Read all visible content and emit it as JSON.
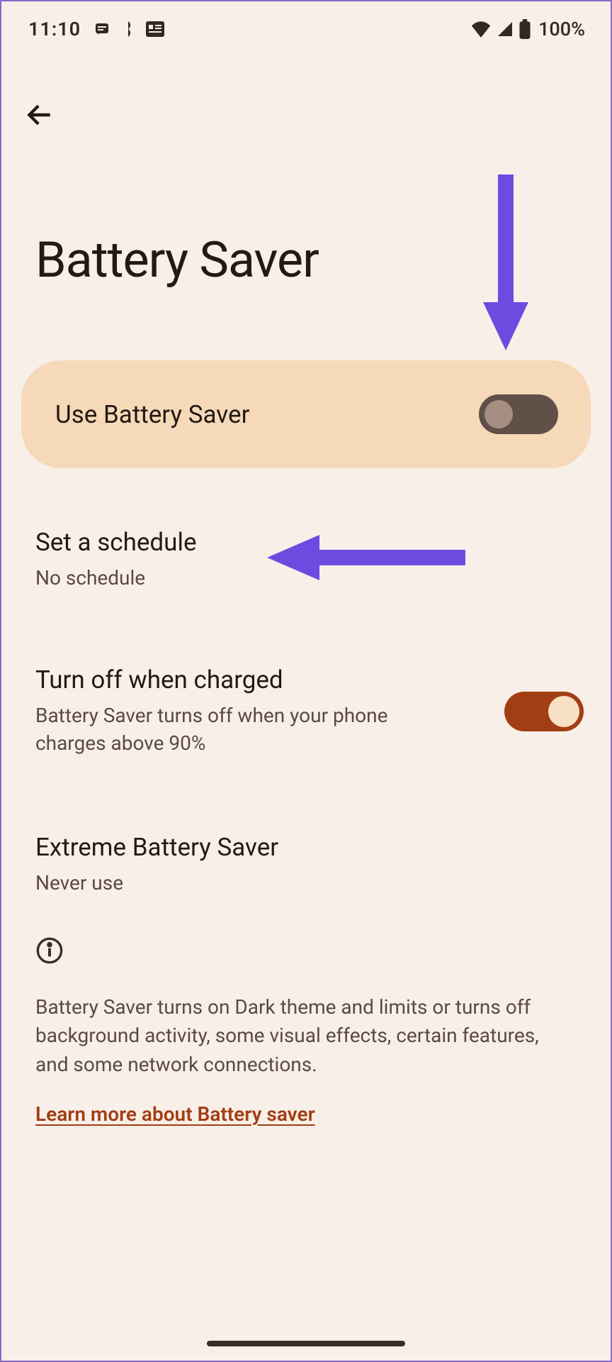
{
  "statusBar": {
    "time": "11:10",
    "batteryText": "100%"
  },
  "header": {
    "title": "Battery Saver"
  },
  "mainToggle": {
    "label": "Use Battery Saver",
    "state": "off"
  },
  "settings": {
    "schedule": {
      "title": "Set a schedule",
      "subtitle": "No schedule"
    },
    "turnOffCharged": {
      "title": "Turn off when charged",
      "subtitle": "Battery Saver turns off when your phone charges above 90%",
      "state": "on"
    },
    "extreme": {
      "title": "Extreme Battery Saver",
      "subtitle": "Never use"
    }
  },
  "info": {
    "description": "Battery Saver turns on Dark theme and limits or turns off background activity, some visual effects, certain features, and some network connections.",
    "linkText": "Learn more about Battery saver"
  },
  "annotations": {
    "arrowColor": "#6f4ae0"
  }
}
